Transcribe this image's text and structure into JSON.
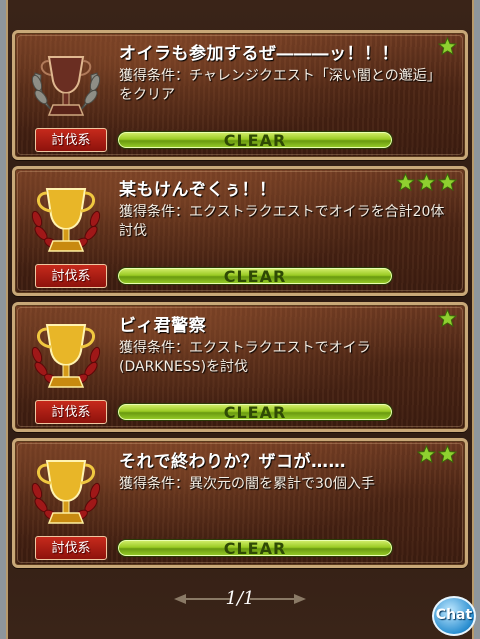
{
  "trophies": [
    {
      "title": "オイラも参加するぜ―――ッ！！！",
      "condition": "獲得条件：チャレンジクエスト「深い闇との邂逅」をクリア",
      "category": "討伐系",
      "status": "CLEAR",
      "stars": 1,
      "trophy_type": "bronze-cup-icon"
    },
    {
      "title": "某もけんぞくぅ！！",
      "condition": "獲得条件：エクストラクエストでオイラを合計20体討伐",
      "category": "討伐系",
      "status": "CLEAR",
      "stars": 3,
      "trophy_type": "gold-cup-icon"
    },
    {
      "title": "ビィ君警察",
      "condition": "獲得条件：エクストラクエストでオイラ(DARKNESS)を討伐",
      "category": "討伐系",
      "status": "CLEAR",
      "stars": 1,
      "trophy_type": "gold-cup-icon"
    },
    {
      "title": "それで終わりか？ザコが……",
      "condition": "獲得条件：異次元の闇を累計で30個入手",
      "category": "討伐系",
      "status": "CLEAR",
      "stars": 2,
      "trophy_type": "gold-cup-icon"
    }
  ],
  "pager": {
    "label": "1/1"
  },
  "chat": {
    "label": "Chat"
  },
  "colors": {
    "star": "#8fd030",
    "clear_bar": "#9bcc24",
    "category": "#b01c12"
  }
}
